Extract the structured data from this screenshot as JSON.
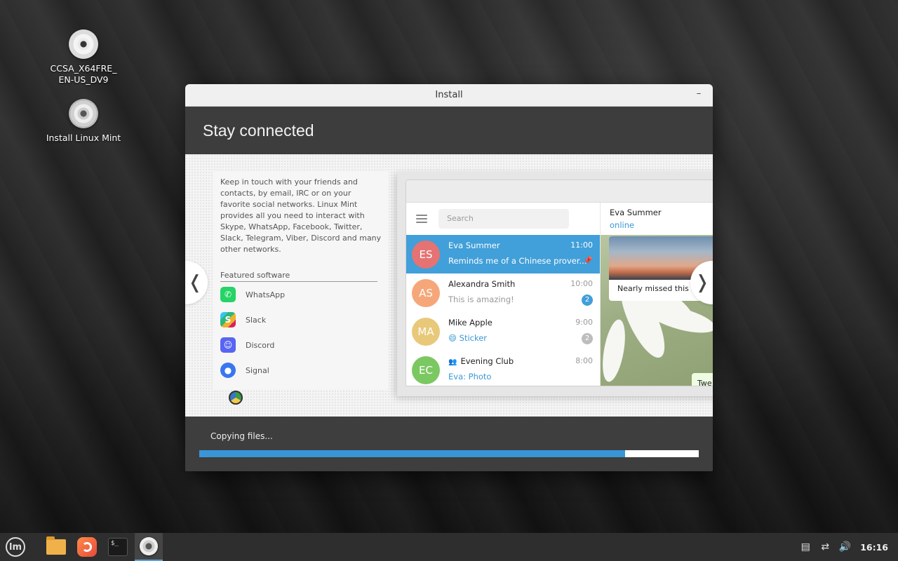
{
  "desktop": {
    "icons": [
      {
        "label": "CCSA_X64FRE_\nEN-US_DV9",
        "line1": "CCSA_X64FRE_",
        "line2": "EN-US_DV9",
        "icon": "disc-icon"
      },
      {
        "label": "Install Linux Mint",
        "icon": "cd-icon"
      }
    ]
  },
  "window": {
    "title": "Install",
    "minimize_label": "–",
    "heading": "Stay connected",
    "slide": {
      "description": "Keep in touch with your friends and contacts, by email, IRC or on your favorite social networks. Linux Mint provides all you need to interact with Skype, WhatsApp, Facebook, Twitter, Slack, Telegram, Viber, Discord and many other networks.",
      "featured_title": "Featured software",
      "apps": [
        {
          "name": "WhatsApp",
          "icon": "whatsapp-icon",
          "color": "#25d366"
        },
        {
          "name": "Slack",
          "icon": "slack-icon",
          "color": "#4a154b"
        },
        {
          "name": "Discord",
          "icon": "discord-icon",
          "color": "#5865f2"
        },
        {
          "name": "Signal",
          "icon": "signal-icon",
          "color": "#3a76f0"
        }
      ],
      "prev_arrow": "❬",
      "next_arrow": "❭",
      "telegram": {
        "search_placeholder": "Search",
        "chats": [
          {
            "initials": "ES",
            "name": "Eva Summer",
            "time": "11:00",
            "message": "Reminds me of a Chinese prover...",
            "avatar_color": "#e57373",
            "active": true,
            "pinned": true
          },
          {
            "initials": "AS",
            "name": "Alexandra Smith",
            "time": "10:00",
            "message": "This is amazing!",
            "avatar_color": "#f6a77a",
            "badge": "2",
            "badge_color": "#419fd9"
          },
          {
            "initials": "MA",
            "name": "Mike Apple",
            "time": "9:00",
            "message": "😄 Sticker",
            "avatar_color": "#e8c97a",
            "badge": "2",
            "badge_color": "#bdbdbd"
          },
          {
            "initials": "EC",
            "name": "Evening Club",
            "time": "8:00",
            "message": "Eva: Photo",
            "avatar_color": "#7bc862"
          }
        ],
        "contact_name": "Eva Summer",
        "contact_status": "online",
        "photo_caption": "Nearly missed this s",
        "bubble_text": "Twe"
      }
    },
    "progress": {
      "label": "Copying files...",
      "fraction": 0.853,
      "color": "#3a95d7"
    }
  },
  "taskbar": {
    "apps": [
      {
        "name": "menu",
        "icon": "mint-menu-icon"
      },
      {
        "name": "files",
        "icon": "folder-icon"
      },
      {
        "name": "firefox",
        "icon": "firefox-icon"
      },
      {
        "name": "terminal",
        "icon": "terminal-icon",
        "glyph": "$_"
      },
      {
        "name": "installer",
        "icon": "cd-icon",
        "active": true
      }
    ],
    "mint_logo_text": "lm",
    "clock": "16:16"
  }
}
